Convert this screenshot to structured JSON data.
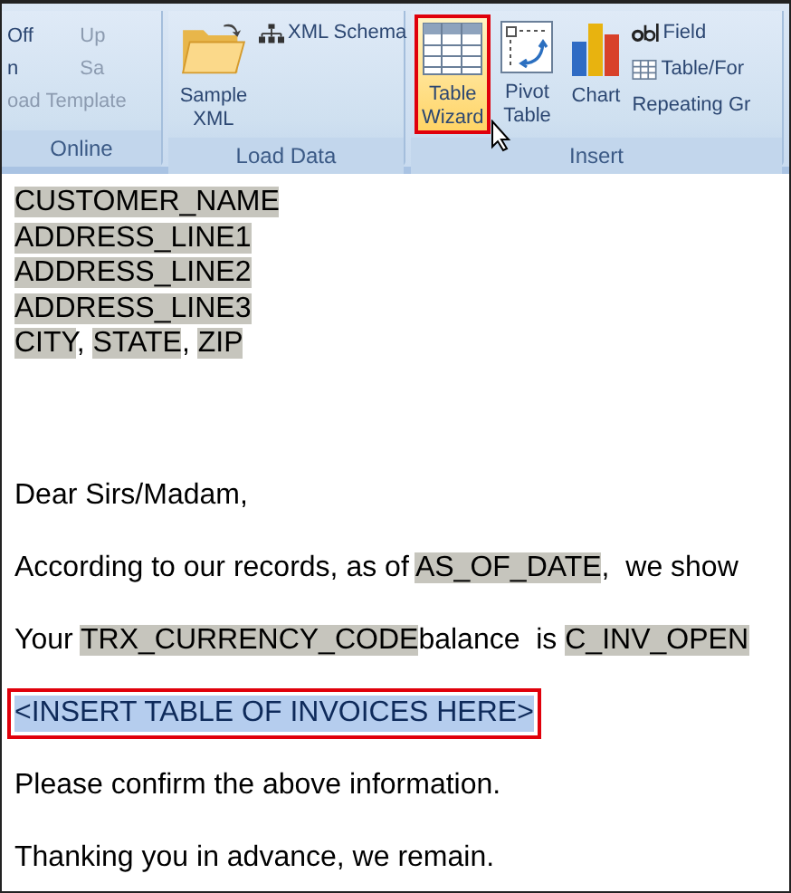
{
  "ribbon": {
    "groups": [
      {
        "label": "Online",
        "items": [
          {
            "kind": "text",
            "label": "Off",
            "disabled": false
          },
          {
            "kind": "text",
            "label": "Up",
            "disabled": true
          },
          {
            "kind": "text",
            "label": "n",
            "disabled": false
          },
          {
            "kind": "text",
            "label": "Sa",
            "disabled": true
          },
          {
            "kind": "text",
            "label": "oad Template",
            "disabled": true
          }
        ]
      },
      {
        "label": "Load Data",
        "items": [
          {
            "kind": "large",
            "label": "Sample XML",
            "selected": false
          },
          {
            "kind": "small",
            "label": "XML Schema"
          }
        ]
      },
      {
        "label": "Insert",
        "items": [
          {
            "kind": "large",
            "label": "Table Wizard",
            "selected": true
          },
          {
            "kind": "large",
            "label": "Pivot Table",
            "selected": false
          },
          {
            "kind": "large",
            "label": "Chart",
            "selected": false
          },
          {
            "kind": "small",
            "label": "Field"
          },
          {
            "kind": "small",
            "label": "Table/For"
          },
          {
            "kind": "small",
            "label": "Repeating Gr"
          }
        ]
      }
    ]
  },
  "document": {
    "blocks": [
      {
        "kind": "address",
        "segments": [
          {
            "kind": "field",
            "text": "CUSTOMER_NAME"
          }
        ]
      },
      {
        "kind": "address",
        "segments": [
          {
            "kind": "field",
            "text": "ADDRESS_LINE1"
          }
        ]
      },
      {
        "kind": "address",
        "segments": [
          {
            "kind": "field",
            "text": "ADDRESS_LINE2"
          }
        ]
      },
      {
        "kind": "address",
        "segments": [
          {
            "kind": "field",
            "text": "ADDRESS_LINE3"
          }
        ]
      },
      {
        "kind": "address",
        "segments": [
          {
            "kind": "field",
            "text": "CITY"
          },
          {
            "kind": "text",
            "text": ", "
          },
          {
            "kind": "field",
            "text": "STATE"
          },
          {
            "kind": "text",
            "text": ", "
          },
          {
            "kind": "field",
            "text": "ZIP"
          }
        ]
      },
      {
        "kind": "paragraph",
        "segments": [
          {
            "kind": "text",
            "text": "Dear Sirs/Madam,"
          }
        ]
      },
      {
        "kind": "paragraph",
        "segments": [
          {
            "kind": "text",
            "text": "According to our records, as of "
          },
          {
            "kind": "field",
            "text": "AS_OF_DATE"
          },
          {
            "kind": "text",
            "text": ",  we show"
          }
        ]
      },
      {
        "kind": "paragraph",
        "segments": [
          {
            "kind": "text",
            "text": "Your "
          },
          {
            "kind": "field",
            "text": "TRX_CURRENCY_CODE"
          },
          {
            "kind": "text",
            "text": "balance  is "
          },
          {
            "kind": "field",
            "text": "C_INV_OPEN"
          }
        ]
      },
      {
        "kind": "placeholder",
        "selected": true,
        "segments": [
          {
            "kind": "text",
            "text": "<INSERT TABLE OF INVOICES HERE>"
          }
        ]
      },
      {
        "kind": "paragraph",
        "segments": [
          {
            "kind": "text",
            "text": "Please confirm the above information."
          }
        ]
      },
      {
        "kind": "paragraph",
        "segments": [
          {
            "kind": "text",
            "text": "Thanking you in advance, we remain."
          }
        ]
      }
    ]
  }
}
